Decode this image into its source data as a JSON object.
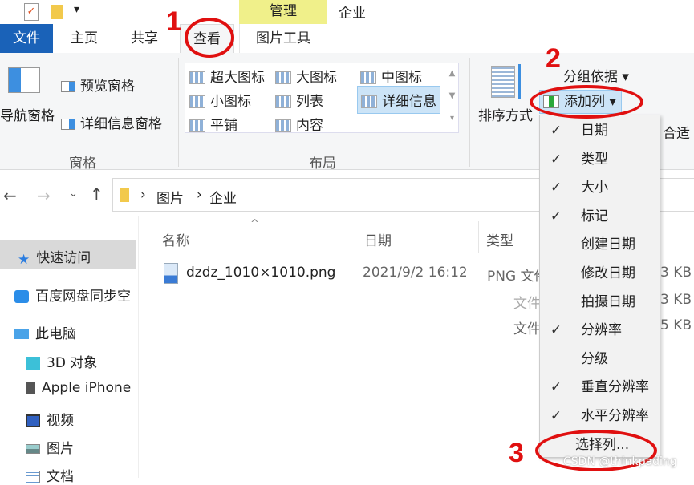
{
  "qat": {
    "check_icon": "checkmark-doc-icon",
    "folder_icon": "folder-icon",
    "dropdown": "▾"
  },
  "context_tab": {
    "label": "管理",
    "color": "#f0f08a"
  },
  "window_title": "企业",
  "tabs": [
    {
      "label": "文件"
    },
    {
      "label": "主页"
    },
    {
      "label": "共享"
    },
    {
      "label": "查看"
    },
    {
      "label": "图片工具"
    }
  ],
  "ribbon": {
    "panes": {
      "nav_pane": "导航窗格",
      "preview_pane": "预览窗格",
      "details_pane": "详细信息窗格",
      "group": "窗格"
    },
    "layout": {
      "items": [
        "超大图标",
        "大图标",
        "中图标",
        "小图标",
        "列表",
        "详细信息",
        "平铺",
        "内容"
      ],
      "selected": "详细信息",
      "group": "布局"
    },
    "current_view": {
      "sort": "排序方式",
      "group_by": "分组依据",
      "add_column": "添加列",
      "size_fit_partial": "合适"
    }
  },
  "address": {
    "path": [
      "图片",
      "企业"
    ]
  },
  "sidebar": [
    {
      "label": "快速访问",
      "icon": "star-icon",
      "selected": true
    },
    {
      "label": "百度网盘同步空",
      "icon": "baidu-netdisk-icon"
    },
    {
      "label": "此电脑",
      "icon": "computer-icon"
    },
    {
      "label": "3D 对象",
      "icon": "cube-icon"
    },
    {
      "label": "Apple iPhone",
      "icon": "phone-icon"
    },
    {
      "label": "视频",
      "icon": "video-icon"
    },
    {
      "label": "图片",
      "icon": "picture-icon"
    },
    {
      "label": "文档",
      "icon": "document-icon"
    }
  ],
  "columns": [
    "名称",
    "日期",
    "类型"
  ],
  "files": [
    {
      "name": "dzdz_1010×1010.png",
      "date": "2021/9/2 16:12",
      "type": "PNG 文件",
      "size": "3 KB"
    },
    {
      "name": "",
      "date": "",
      "type": "文件",
      "size": "3 KB"
    },
    {
      "name": "",
      "date": "",
      "type": "文件",
      "size": "5 KB"
    }
  ],
  "add_column_menu": {
    "items": [
      {
        "label": "日期",
        "checked": true
      },
      {
        "label": "类型",
        "checked": true
      },
      {
        "label": "大小",
        "checked": true
      },
      {
        "label": "标记",
        "checked": true
      },
      {
        "label": "创建日期",
        "checked": false
      },
      {
        "label": "修改日期",
        "checked": false
      },
      {
        "label": "拍摄日期",
        "checked": false
      },
      {
        "label": "分辨率",
        "checked": true
      },
      {
        "label": "分级",
        "checked": false
      },
      {
        "label": "垂直分辨率",
        "checked": true
      },
      {
        "label": "水平分辨率",
        "checked": true
      }
    ],
    "choose": "选择列..."
  },
  "annotations": [
    "1",
    "2",
    "3"
  ],
  "annotation_color": "#e01010",
  "watermark": "CSDN @thinkpading"
}
